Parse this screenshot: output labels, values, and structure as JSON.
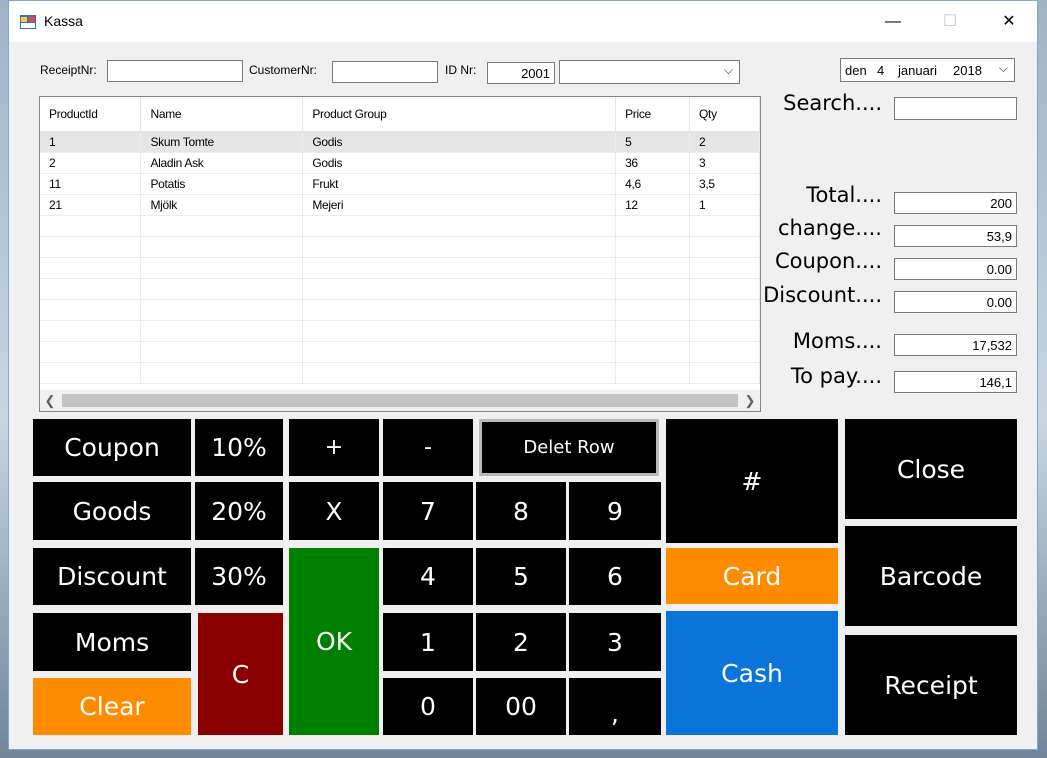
{
  "window": {
    "title": "Kassa",
    "minimize": "—",
    "maximize": "☐",
    "close": "✕"
  },
  "header": {
    "receipt_label": "ReceiptNr:",
    "receipt_value": "",
    "customer_label": "CustomerNr:",
    "customer_value": "",
    "id_label": "ID Nr:",
    "id_value": "2001",
    "id_combo_value": "",
    "date": {
      "prefix": "den",
      "day": "4",
      "month": "januari",
      "year": "2018"
    }
  },
  "grid": {
    "columns": [
      "ProductId",
      "Name",
      "Product Group",
      "Price",
      "Qty"
    ],
    "rows": [
      [
        "1",
        "Skum Tomte",
        "Godis",
        "5",
        "2"
      ],
      [
        "2",
        "Aladin Ask",
        "Godis",
        "36",
        "3"
      ],
      [
        "11",
        "Potatis",
        "Frukt",
        "4,6",
        "3,5"
      ],
      [
        "21",
        "Mjölk",
        "Mejeri",
        "12",
        "1"
      ]
    ],
    "empty_rows": 8
  },
  "side": {
    "search_label": "Search....",
    "search_value": "",
    "total_label": "Total....",
    "total_value": "200",
    "change_label": "change....",
    "change_value": "53,9",
    "coupon_label": "Coupon....",
    "coupon_value": "0.00",
    "discount_label": "Discount....",
    "discount_value": "0.00",
    "moms_label": "Moms....",
    "moms_value": "17,532",
    "topay_label": "To pay....",
    "topay_value": "146,1"
  },
  "keys": {
    "coupon": "Coupon",
    "goods": "Goods",
    "discount": "Discount",
    "moms": "Moms",
    "clear": "Clear",
    "p10": "10%",
    "p20": "20%",
    "p30": "30%",
    "c": "C",
    "plus": "+",
    "minus": "-",
    "delet_row": "Delet Row",
    "x": "X",
    "ok": "OK",
    "n7": "7",
    "n8": "8",
    "n9": "9",
    "n4": "4",
    "n5": "5",
    "n6": "6",
    "n1": "1",
    "n2": "2",
    "n3": "3",
    "n0": "0",
    "n00": "00",
    "comma": ",",
    "hash": "#",
    "card": "Card",
    "cash": "Cash",
    "close": "Close",
    "barcode": "Barcode",
    "receipt": "Receipt"
  },
  "colors": {
    "orange": "#ff8c00",
    "red": "#8b0000",
    "green": "#008000",
    "blue": "#0a74da",
    "key_black": "#000000"
  }
}
